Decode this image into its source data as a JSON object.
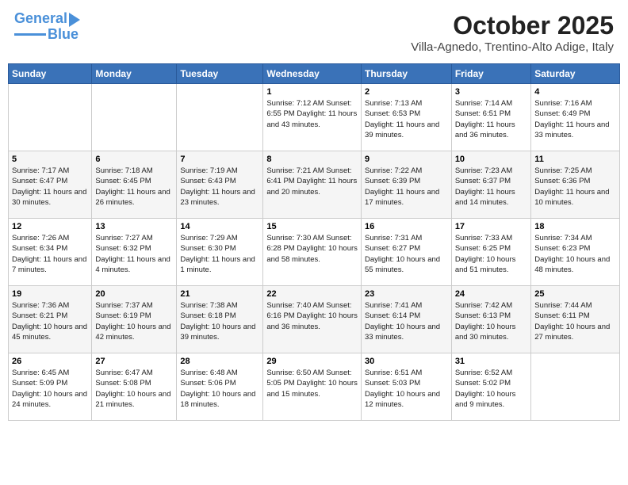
{
  "logo": {
    "line1": "General",
    "line2": "Blue"
  },
  "title": "October 2025",
  "subtitle": "Villa-Agnedo, Trentino-Alto Adige, Italy",
  "weekdays": [
    "Sunday",
    "Monday",
    "Tuesday",
    "Wednesday",
    "Thursday",
    "Friday",
    "Saturday"
  ],
  "weeks": [
    [
      {
        "day": "",
        "info": ""
      },
      {
        "day": "",
        "info": ""
      },
      {
        "day": "",
        "info": ""
      },
      {
        "day": "1",
        "info": "Sunrise: 7:12 AM\nSunset: 6:55 PM\nDaylight: 11 hours\nand 43 minutes."
      },
      {
        "day": "2",
        "info": "Sunrise: 7:13 AM\nSunset: 6:53 PM\nDaylight: 11 hours\nand 39 minutes."
      },
      {
        "day": "3",
        "info": "Sunrise: 7:14 AM\nSunset: 6:51 PM\nDaylight: 11 hours\nand 36 minutes."
      },
      {
        "day": "4",
        "info": "Sunrise: 7:16 AM\nSunset: 6:49 PM\nDaylight: 11 hours\nand 33 minutes."
      }
    ],
    [
      {
        "day": "5",
        "info": "Sunrise: 7:17 AM\nSunset: 6:47 PM\nDaylight: 11 hours\nand 30 minutes."
      },
      {
        "day": "6",
        "info": "Sunrise: 7:18 AM\nSunset: 6:45 PM\nDaylight: 11 hours\nand 26 minutes."
      },
      {
        "day": "7",
        "info": "Sunrise: 7:19 AM\nSunset: 6:43 PM\nDaylight: 11 hours\nand 23 minutes."
      },
      {
        "day": "8",
        "info": "Sunrise: 7:21 AM\nSunset: 6:41 PM\nDaylight: 11 hours\nand 20 minutes."
      },
      {
        "day": "9",
        "info": "Sunrise: 7:22 AM\nSunset: 6:39 PM\nDaylight: 11 hours\nand 17 minutes."
      },
      {
        "day": "10",
        "info": "Sunrise: 7:23 AM\nSunset: 6:37 PM\nDaylight: 11 hours\nand 14 minutes."
      },
      {
        "day": "11",
        "info": "Sunrise: 7:25 AM\nSunset: 6:36 PM\nDaylight: 11 hours\nand 10 minutes."
      }
    ],
    [
      {
        "day": "12",
        "info": "Sunrise: 7:26 AM\nSunset: 6:34 PM\nDaylight: 11 hours\nand 7 minutes."
      },
      {
        "day": "13",
        "info": "Sunrise: 7:27 AM\nSunset: 6:32 PM\nDaylight: 11 hours\nand 4 minutes."
      },
      {
        "day": "14",
        "info": "Sunrise: 7:29 AM\nSunset: 6:30 PM\nDaylight: 11 hours\nand 1 minute."
      },
      {
        "day": "15",
        "info": "Sunrise: 7:30 AM\nSunset: 6:28 PM\nDaylight: 10 hours\nand 58 minutes."
      },
      {
        "day": "16",
        "info": "Sunrise: 7:31 AM\nSunset: 6:27 PM\nDaylight: 10 hours\nand 55 minutes."
      },
      {
        "day": "17",
        "info": "Sunrise: 7:33 AM\nSunset: 6:25 PM\nDaylight: 10 hours\nand 51 minutes."
      },
      {
        "day": "18",
        "info": "Sunrise: 7:34 AM\nSunset: 6:23 PM\nDaylight: 10 hours\nand 48 minutes."
      }
    ],
    [
      {
        "day": "19",
        "info": "Sunrise: 7:36 AM\nSunset: 6:21 PM\nDaylight: 10 hours\nand 45 minutes."
      },
      {
        "day": "20",
        "info": "Sunrise: 7:37 AM\nSunset: 6:19 PM\nDaylight: 10 hours\nand 42 minutes."
      },
      {
        "day": "21",
        "info": "Sunrise: 7:38 AM\nSunset: 6:18 PM\nDaylight: 10 hours\nand 39 minutes."
      },
      {
        "day": "22",
        "info": "Sunrise: 7:40 AM\nSunset: 6:16 PM\nDaylight: 10 hours\nand 36 minutes."
      },
      {
        "day": "23",
        "info": "Sunrise: 7:41 AM\nSunset: 6:14 PM\nDaylight: 10 hours\nand 33 minutes."
      },
      {
        "day": "24",
        "info": "Sunrise: 7:42 AM\nSunset: 6:13 PM\nDaylight: 10 hours\nand 30 minutes."
      },
      {
        "day": "25",
        "info": "Sunrise: 7:44 AM\nSunset: 6:11 PM\nDaylight: 10 hours\nand 27 minutes."
      }
    ],
    [
      {
        "day": "26",
        "info": "Sunrise: 6:45 AM\nSunset: 5:09 PM\nDaylight: 10 hours\nand 24 minutes."
      },
      {
        "day": "27",
        "info": "Sunrise: 6:47 AM\nSunset: 5:08 PM\nDaylight: 10 hours\nand 21 minutes."
      },
      {
        "day": "28",
        "info": "Sunrise: 6:48 AM\nSunset: 5:06 PM\nDaylight: 10 hours\nand 18 minutes."
      },
      {
        "day": "29",
        "info": "Sunrise: 6:50 AM\nSunset: 5:05 PM\nDaylight: 10 hours\nand 15 minutes."
      },
      {
        "day": "30",
        "info": "Sunrise: 6:51 AM\nSunset: 5:03 PM\nDaylight: 10 hours\nand 12 minutes."
      },
      {
        "day": "31",
        "info": "Sunrise: 6:52 AM\nSunset: 5:02 PM\nDaylight: 10 hours\nand 9 minutes."
      },
      {
        "day": "",
        "info": ""
      }
    ]
  ]
}
